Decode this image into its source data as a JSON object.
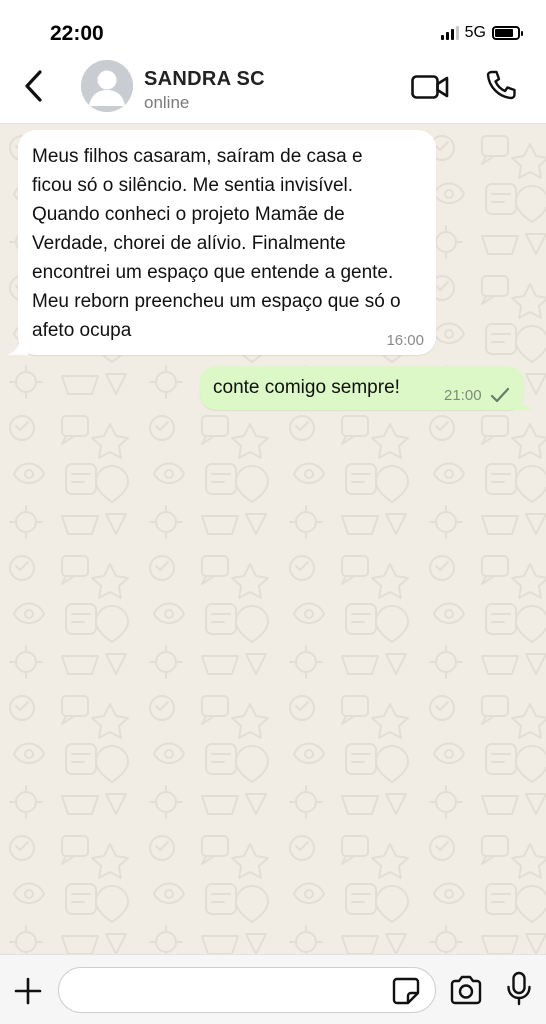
{
  "status_bar": {
    "time": "22:00",
    "network": "5G",
    "battery_level": 0.8
  },
  "header": {
    "contact_name": "SANDRA SC",
    "contact_status": "online",
    "icons": [
      "back-chevron-icon",
      "avatar-placeholder-icon",
      "video-camera-icon",
      "phone-icon"
    ]
  },
  "messages": [
    {
      "direction": "incoming",
      "text": "Meus filhos casaram, saíram de casa e ficou só o silêncio. Me sentia invisível. Quando conheci o projeto Mamãe de Verdade, chorei de alívio. Finalmente encontrei um espaço que entende a gente. Meu reborn preencheu um espaço que só o afeto ocupa",
      "time": "16:00"
    },
    {
      "direction": "outgoing",
      "text": "conte comigo sempre!",
      "time": "21:00",
      "status_icon": "single-check-icon"
    }
  ],
  "composer": {
    "input_value": "",
    "placeholder": "",
    "icons": [
      "plus-icon",
      "sticker-icon",
      "camera-icon",
      "microphone-icon"
    ]
  },
  "colors": {
    "wallpaper": "#f1ede5",
    "outgoing_bubble": "#dcf8c6",
    "incoming_bubble": "#ffffff"
  }
}
